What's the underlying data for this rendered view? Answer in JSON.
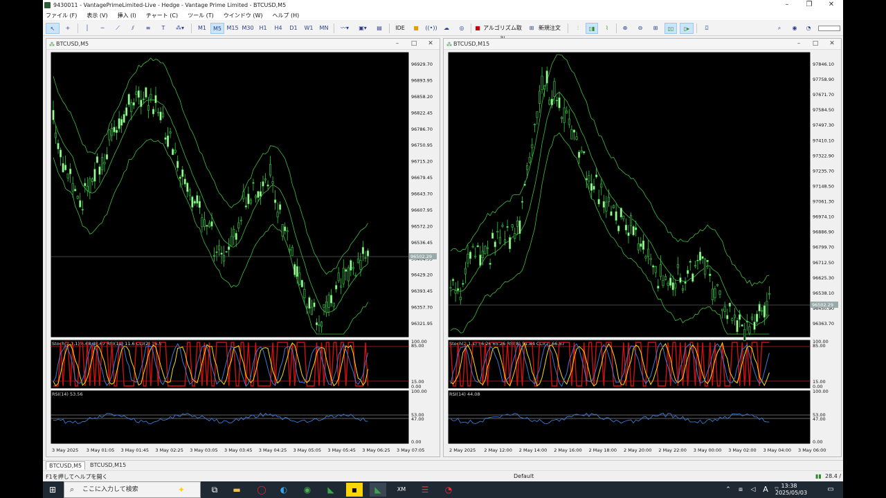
{
  "window": {
    "title": "9430011 - VantagePrimeLimited-Live - Hedge - Vantage Prime Limited - BTCUSD,M5",
    "controls": [
      "–",
      "❐",
      "✕"
    ]
  },
  "menu": [
    "ファイル (F)",
    "表示 (V)",
    "挿入 (I)",
    "チャート (C)",
    "ツール (T)",
    "ウインドウ (W)",
    "ヘルプ (H)"
  ],
  "toolbar": {
    "timeframes": [
      "M1",
      "M5",
      "M15",
      "M30",
      "H1",
      "H4",
      "D1",
      "W1",
      "MN"
    ],
    "selected_timeframe": "M5",
    "ide_label": "IDE",
    "algo_label": "アルゴリズム取引",
    "neworder_label": "新規注文"
  },
  "charts": [
    {
      "symbol": "BTCUSD,M5",
      "current_price": "96502.29",
      "price_ticks": [
        "96929.70",
        "96893.95",
        "96858.20",
        "96822.45",
        "96786.70",
        "96750.95",
        "96715.20",
        "96679.45",
        "96643.70",
        "96607.95",
        "96572.20",
        "96536.45",
        "96464.95",
        "96429.20",
        "96393.45",
        "96357.70",
        "96321.95"
      ],
      "stoch_label": "Stoch(2,1,1) 4.68 48.67 RSI(11) 11.6 CCI(2) 16.5",
      "stoch_ticks": [
        "100.00",
        "85.00",
        "15.00",
        "0.00"
      ],
      "rsi_label": "RSI(14) 53.56",
      "rsi_ticks": [
        "100.00",
        "53.00",
        "47.00",
        "0.00"
      ],
      "time_labels": [
        "3 May 2025",
        "3 May 01:05",
        "3 May 01:45",
        "3 May 02:25",
        "3 May 03:05",
        "3 May 03:45",
        "3 May 04:25",
        "3 May 05:05",
        "3 May 05:45",
        "3 May 06:25",
        "3 May 07:05"
      ]
    },
    {
      "symbol": "BTCUSD,M15",
      "current_price": "96502.29",
      "price_ticks": [
        "97846.10",
        "97758.90",
        "97671.70",
        "97584.50",
        "97497.30",
        "97410.10",
        "97322.90",
        "97235.70",
        "97148.50",
        "97061.30",
        "96974.10",
        "96886.90",
        "96799.70",
        "96712.50",
        "96625.30",
        "96538.10",
        "96450.90",
        "96363.70"
      ],
      "stoch_label": "Stoch(2,1,1) 56.26 65.26 RSI(8) 51.84 CCI(2) 66.67",
      "stoch_ticks": [
        "100.00",
        "85.00",
        "15.00",
        "0.00"
      ],
      "rsi_label": "RSI(14) 44.08",
      "rsi_ticks": [
        "100.00",
        "53.00",
        "47.00",
        "0.00"
      ],
      "time_labels": [
        "2 May 2025",
        "2 May 12:00",
        "2 May 14:00",
        "2 May 16:00",
        "2 May 18:00",
        "2 May 20:00",
        "2 May 22:00",
        "3 May 00:00",
        "3 May 02:00",
        "3 May 04:00",
        "3 May 06:00"
      ]
    }
  ],
  "tabs": [
    "BTCUSD,M5",
    "BTCUSD,M15"
  ],
  "status": {
    "help": "F1を押してヘルプを開く",
    "profile": "Default",
    "conn": "28.4 /"
  },
  "taskbar": {
    "search_placeholder": "ここに入力して検索",
    "time": "13:38",
    "date": "2025/05/03",
    "ime": "A"
  },
  "colors": {
    "bull": "#b9f3a9",
    "bear": "#1a1a1a",
    "wick": "#2ecc40",
    "band": "#3fbf3f",
    "stoch_red": "#d01010",
    "stoch_yellow": "#ffe000",
    "stoch_blue": "#3a7bd5",
    "level": "#cc2020"
  }
}
